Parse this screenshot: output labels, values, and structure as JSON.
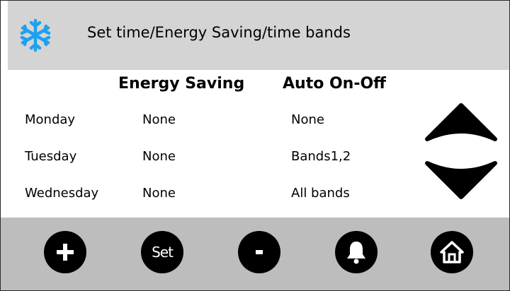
{
  "header": {
    "title": "Set time/Energy Saving/time bands",
    "icon": "snowflake-icon",
    "icon_color": "#1ea0f0",
    "background": "#d4d4d4"
  },
  "columns": {
    "energy_saving": "Energy Saving",
    "auto_on_off": "Auto On-Off"
  },
  "rows": [
    {
      "day": "Monday",
      "energy_saving": "None",
      "auto_on_off": "None"
    },
    {
      "day": "Tuesday",
      "energy_saving": "None",
      "auto_on_off": "Bands1,2"
    },
    {
      "day": "Wednesday",
      "energy_saving": "None",
      "auto_on_off": "All bands"
    }
  ],
  "scroll": {
    "up_icon": "chevron-up-icon",
    "down_icon": "chevron-down-icon"
  },
  "footer": {
    "background": "#bdbdbd",
    "buttons": [
      {
        "icon": "plus-icon"
      },
      {
        "label": "Set"
      },
      {
        "icon": "minus-icon"
      },
      {
        "icon": "bell-icon"
      },
      {
        "icon": "home-icon"
      }
    ]
  }
}
